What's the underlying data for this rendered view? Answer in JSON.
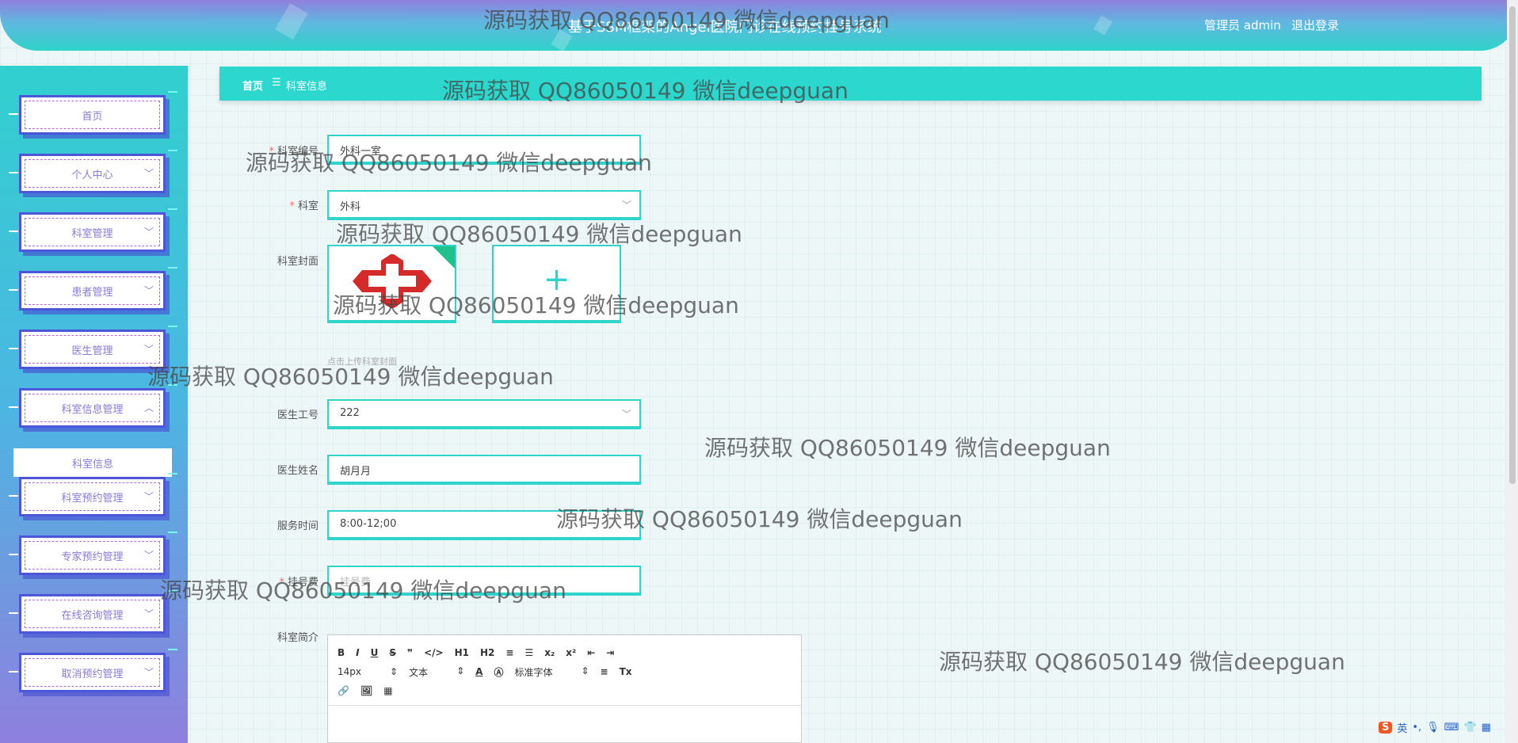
{
  "header": {
    "title": "基于SSM框架的Angel医院门诊在线预约挂号系统",
    "user": "管理员 admin",
    "logout": "退出登录"
  },
  "sidebar": {
    "items": [
      {
        "label": "首页",
        "has_chevron": false
      },
      {
        "label": "个人中心",
        "has_chevron": true
      },
      {
        "label": "科室管理",
        "has_chevron": true
      },
      {
        "label": "患者管理",
        "has_chevron": true
      },
      {
        "label": "医生管理",
        "has_chevron": true
      },
      {
        "label": "科室信息管理",
        "has_chevron": true,
        "expanded": true
      },
      {
        "label": "科室预约管理",
        "has_chevron": true
      },
      {
        "label": "专家预约管理",
        "has_chevron": true
      },
      {
        "label": "在线咨询管理",
        "has_chevron": true
      },
      {
        "label": "取消预约管理",
        "has_chevron": true
      }
    ],
    "sub_item": "科室信息"
  },
  "breadcrumb": {
    "home": "首页",
    "separator": "☰",
    "current": "科室信息"
  },
  "form": {
    "dept_no": {
      "label": "科室编号",
      "value": "外科一室"
    },
    "dept": {
      "label": "科室",
      "value": "外科"
    },
    "cover": {
      "label": "科室封面",
      "tip": "点击上传科室封面"
    },
    "doctor_no": {
      "label": "医生工号",
      "value": "222"
    },
    "doctor_name": {
      "label": "医生姓名",
      "value": "胡月月"
    },
    "service_time": {
      "label": "服务时间",
      "value": "8:00-12;00"
    },
    "fee": {
      "label": "挂号费",
      "placeholder": "挂号费"
    },
    "intro": {
      "label": "科室简介"
    }
  },
  "editor_toolbar": {
    "row1": [
      "B",
      "I",
      "U",
      "S",
      "❞",
      "</>",
      "H1",
      "H2",
      "≡",
      "☰",
      "x₂",
      "x²",
      "⇤",
      "⇥"
    ],
    "font_size": "14px",
    "text_type": "文本",
    "font_family": "标准字体",
    "row3": [
      "🔗",
      "🖼",
      "▦"
    ]
  },
  "watermark": "源码获取 QQ86050149 微信deepguan",
  "ime": {
    "logo": "S",
    "lang": "英"
  },
  "colors": {
    "accent": "#2fd5cb",
    "menu_border": "#4d55d9",
    "menu_text": "#8a7ad8",
    "required": "#f56c6c"
  }
}
